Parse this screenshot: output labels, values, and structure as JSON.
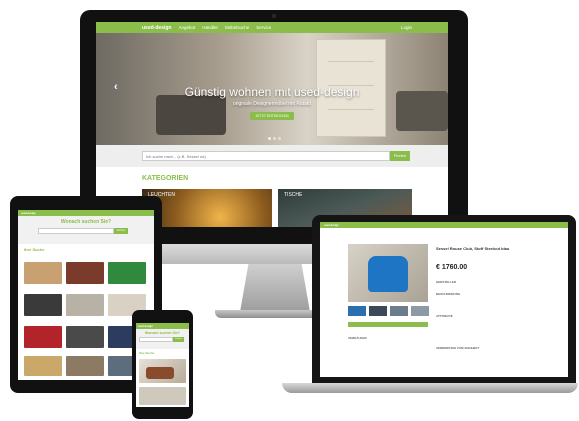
{
  "brand": {
    "logo": "used-design",
    "accent": "#8bbd4b"
  },
  "desktop": {
    "nav": {
      "items": [
        "Angebot",
        "Händler",
        "Möbelsuche",
        "Service"
      ],
      "login": "Login"
    },
    "hero": {
      "title": "Günstig wohnen mit used-design",
      "subtitle": "originale Designermöbel mit Rabatt",
      "button": "JETZT ENTDECKEN",
      "prev_icon": "chevron-left-icon"
    },
    "search": {
      "placeholder": "Ich suche nach... (z.B. Sessel rot)",
      "button": "Finden"
    },
    "categories": {
      "title": "KATEGORIEN",
      "items": [
        "LEUCHTEN",
        "TISCHE"
      ]
    }
  },
  "tablet": {
    "heading": "Wonach suchen Sie?",
    "search_button": "Suchen",
    "section": "Ihre Suche"
  },
  "phone": {
    "heading": "Wonach suchen Sie?",
    "search_button": "Suchen",
    "section": "Ihre Suche"
  },
  "laptop": {
    "product_title": "Sessel Rouse Club, Stoff Steelcut blau",
    "price": "€ 1760.00",
    "labels": [
      "HERSTELLER",
      "BESCHREIBUNG",
      "ATTRIBUTE",
      "VERKÄUFER",
      "VERBINDUNG ZUM ANGEBOT"
    ]
  }
}
